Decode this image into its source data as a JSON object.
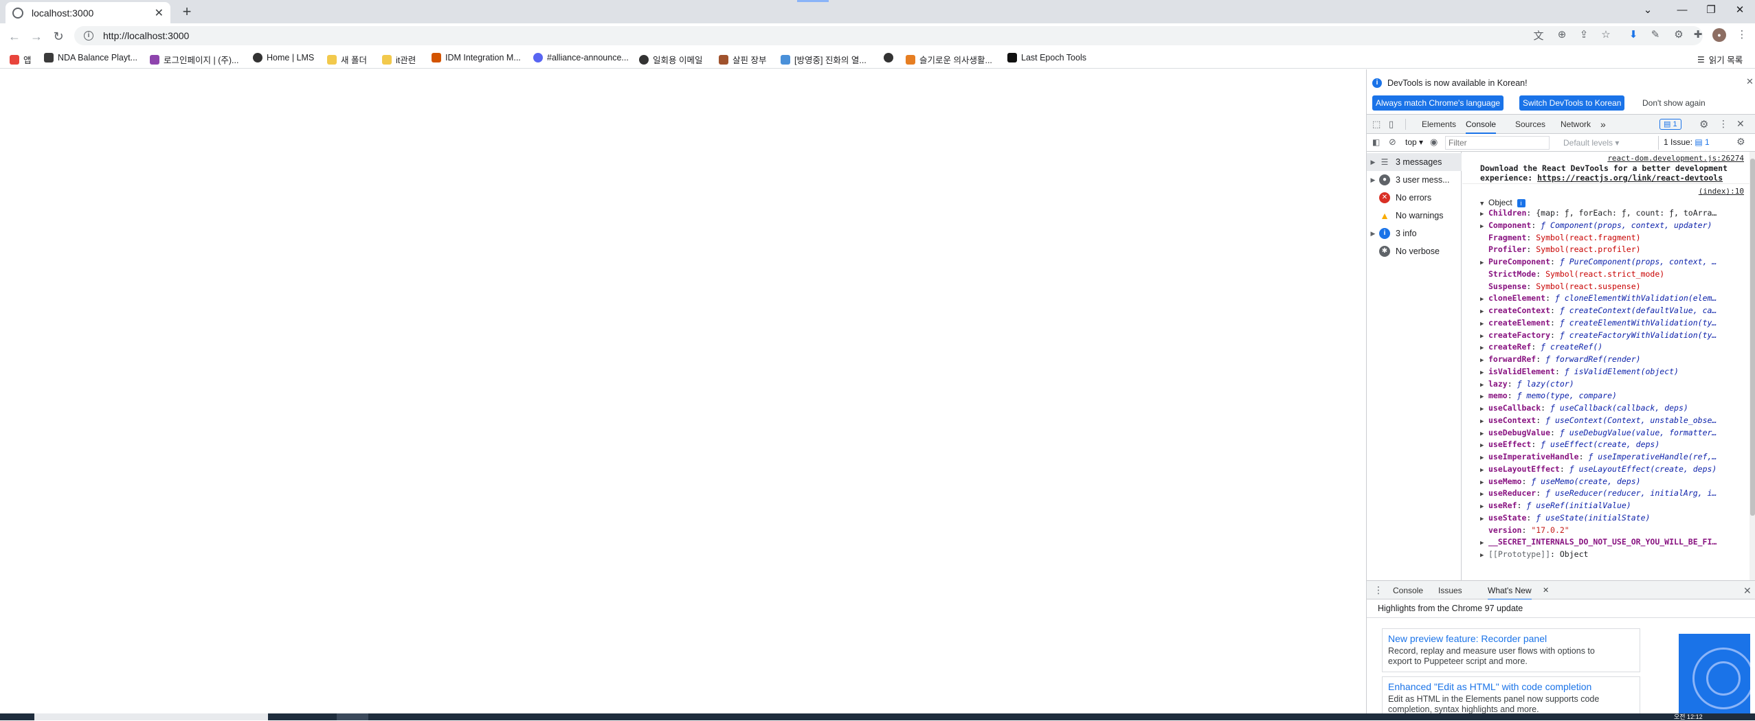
{
  "browser": {
    "tab_title": "localhost:3000",
    "tab_close": "✕",
    "new_tab": "+",
    "window_controls": [
      "⌄",
      "—",
      "❐",
      "✕"
    ],
    "url": "http://localhost:3000",
    "bookmarks": [
      {
        "label": "앱",
        "color": "#e8453c"
      },
      {
        "label": "NDA Balance Playt...",
        "color": "#3b3b3b"
      },
      {
        "label": "로그인페이지 | (주)...",
        "color": "#8e44ad"
      },
      {
        "label": "Home | LMS",
        "color": "#333333"
      },
      {
        "label": "새 폴더",
        "color": "#f2c94c"
      },
      {
        "label": "it관련",
        "color": "#f2c94c"
      },
      {
        "label": "IDM Integration M...",
        "color": "#d35400"
      },
      {
        "label": "#alliance-announce...",
        "color": "#5865f2"
      },
      {
        "label": "일회용 이메일",
        "color": "#333333"
      },
      {
        "label": "살핀 장부",
        "color": "#a0522d"
      },
      {
        "label": "[방영중] 진화의 열...",
        "color": "#4a90d9"
      },
      {
        "label": "",
        "color": "#333333"
      },
      {
        "label": "슬기로운 의사생활...",
        "color": "#e67e22"
      },
      {
        "label": "Last Epoch Tools",
        "color": "#111111"
      }
    ],
    "reading_list": "읽기 목록"
  },
  "devtools": {
    "infobar": {
      "message": "DevTools is now available in Korean!",
      "btn_match": "Always match Chrome's language",
      "btn_switch": "Switch DevTools to Korean",
      "btn_dismiss": "Don't show again"
    },
    "tabs": [
      "Elements",
      "Console",
      "Sources",
      "Network"
    ],
    "more_tabs": "»",
    "issues_badge": "1",
    "toolbar": {
      "context": "top",
      "filter_placeholder": "Filter",
      "levels": "Default levels",
      "issues": "1 Issue:",
      "issues_count": "1"
    },
    "sidebar": [
      {
        "label": "3 messages",
        "icon": "list-icon",
        "expandable": true
      },
      {
        "label": "3 user mess...",
        "icon": "user-icon",
        "expandable": true
      },
      {
        "label": "No errors",
        "icon": "error-icon",
        "expandable": false
      },
      {
        "label": "No warnings",
        "icon": "warning-icon",
        "expandable": false
      },
      {
        "label": "3 info",
        "icon": "info-icon",
        "expandable": true
      },
      {
        "label": "No verbose",
        "icon": "verbose-icon",
        "expandable": false
      }
    ],
    "console": {
      "src1": "react-dom.development.js:26274",
      "msg1a": "Download the React DevTools for a better development",
      "msg1b": "experience: ",
      "msg1link": "https://reactjs.org/link/react-devtools",
      "src2": "(index):10",
      "object_label": "Object",
      "props": [
        {
          "key": "Children",
          "val": "{map: ƒ, forEach: ƒ, count: ƒ, toArra…",
          "type": "obj",
          "exp": true
        },
        {
          "key": "Component",
          "val": "ƒ Component(props, context, updater)",
          "type": "fn",
          "exp": true
        },
        {
          "key": "Fragment",
          "val": "Symbol(react.fragment)",
          "type": "sym",
          "exp": false
        },
        {
          "key": "Profiler",
          "val": "Symbol(react.profiler)",
          "type": "sym",
          "exp": false
        },
        {
          "key": "PureComponent",
          "val": "ƒ PureComponent(props, context, …",
          "type": "fn",
          "exp": true
        },
        {
          "key": "StrictMode",
          "val": "Symbol(react.strict_mode)",
          "type": "sym",
          "exp": false
        },
        {
          "key": "Suspense",
          "val": "Symbol(react.suspense)",
          "type": "sym",
          "exp": false
        },
        {
          "key": "cloneElement",
          "val": "ƒ cloneElementWithValidation(elem…",
          "type": "fn",
          "exp": true
        },
        {
          "key": "createContext",
          "val": "ƒ createContext(defaultValue, ca…",
          "type": "fn",
          "exp": true
        },
        {
          "key": "createElement",
          "val": "ƒ createElementWithValidation(ty…",
          "type": "fn",
          "exp": true
        },
        {
          "key": "createFactory",
          "val": "ƒ createFactoryWithValidation(ty…",
          "type": "fn",
          "exp": true
        },
        {
          "key": "createRef",
          "val": "ƒ createRef()",
          "type": "fn",
          "exp": true
        },
        {
          "key": "forwardRef",
          "val": "ƒ forwardRef(render)",
          "type": "fn",
          "exp": true
        },
        {
          "key": "isValidElement",
          "val": "ƒ isValidElement(object)",
          "type": "fn",
          "exp": true
        },
        {
          "key": "lazy",
          "val": "ƒ lazy(ctor)",
          "type": "fn",
          "exp": true
        },
        {
          "key": "memo",
          "val": "ƒ memo(type, compare)",
          "type": "fn",
          "exp": true
        },
        {
          "key": "useCallback",
          "val": "ƒ useCallback(callback, deps)",
          "type": "fn",
          "exp": true
        },
        {
          "key": "useContext",
          "val": "ƒ useContext(Context, unstable_obse…",
          "type": "fn",
          "exp": true
        },
        {
          "key": "useDebugValue",
          "val": "ƒ useDebugValue(value, formatter…",
          "type": "fn",
          "exp": true
        },
        {
          "key": "useEffect",
          "val": "ƒ useEffect(create, deps)",
          "type": "fn",
          "exp": true
        },
        {
          "key": "useImperativeHandle",
          "val": "ƒ useImperativeHandle(ref,…",
          "type": "fn",
          "exp": true
        },
        {
          "key": "useLayoutEffect",
          "val": "ƒ useLayoutEffect(create, deps)",
          "type": "fn",
          "exp": true
        },
        {
          "key": "useMemo",
          "val": "ƒ useMemo(create, deps)",
          "type": "fn",
          "exp": true
        },
        {
          "key": "useReducer",
          "val": "ƒ useReducer(reducer, initialArg, i…",
          "type": "fn",
          "exp": true
        },
        {
          "key": "useRef",
          "val": "ƒ useRef(initialValue)",
          "type": "fn",
          "exp": true
        },
        {
          "key": "useState",
          "val": "ƒ useState(initialState)",
          "type": "fn",
          "exp": true
        },
        {
          "key": "version",
          "val": "\"17.0.2\"",
          "type": "str",
          "exp": false
        },
        {
          "key": "__SECRET_INTERNALS_DO_NOT_USE_OR_YOU_WILL_BE_FI…",
          "val": "",
          "type": "obj",
          "exp": true
        },
        {
          "key": "[[Prototype]]",
          "val": "Object",
          "type": "proto",
          "exp": true
        }
      ]
    },
    "drawer": {
      "tabs": [
        "Console",
        "Issues",
        "What's New"
      ],
      "heading": "Highlights from the Chrome 97 update",
      "cards": [
        {
          "title": "New preview feature: Recorder panel",
          "desc1": "Record, replay and measure user flows with options to",
          "desc2": "export to Puppeteer script and more."
        },
        {
          "title": "Enhanced \"Edit as HTML\" with code completion",
          "desc1": "Edit as HTML in the Elements panel now supports code",
          "desc2": "completion, syntax highlights and more."
        }
      ]
    },
    "colors": {
      "accent": "#1a73e8",
      "error": "#d93025",
      "warning": "#f9ab00",
      "info": "#1a73e8"
    }
  },
  "taskbar": {
    "clock": "오전 12:12"
  }
}
